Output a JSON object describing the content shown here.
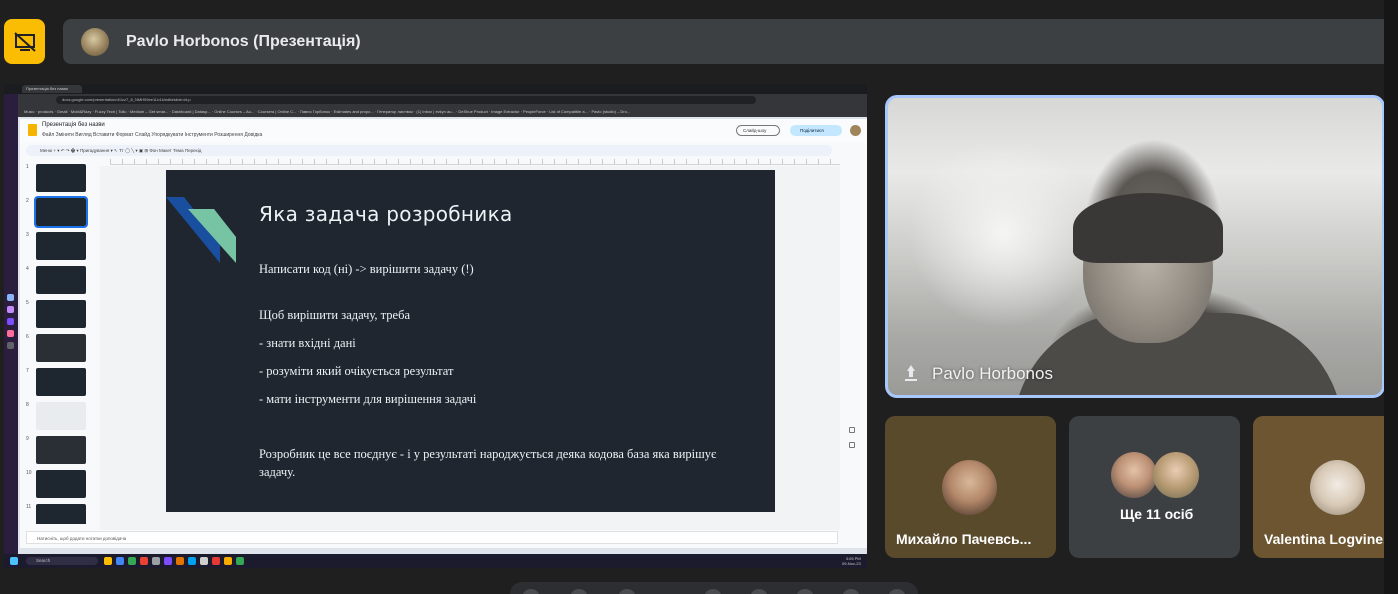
{
  "meeting": {
    "presenter_label": "Pavlo Horbonos (Презентація)"
  },
  "shared_screen": {
    "browser": {
      "tab_title": "Презентація без назви",
      "url": "docs.google.com/presentation/d/1cz7_8_NMH09ee1Lb1k/edit#slide=id.p",
      "bookmarks": "Music · products · Gmail · Mobi&Razy · Fuzzy Tech | Tollu · Medium – Get smar... · Dashboard | Datasp... · Online Courses – Au... · Coursera | Online C... · Павло Горбонос · Estimates and propo... · Генератор листівок · (1) Inbox | evkyn au... · DeShue Product · Image Extractor · PeopleForce · List of Compatible a... · Pavlo (studio) – Dro..."
    },
    "slides_app": {
      "doc_title": "Презентація без назви",
      "menu": "Файл   Змінити   Вигляд   Вставити   Формат   Слайд   Упорядкувати   Інструменти   Розширення   Довідка",
      "slideshow_button": "Слайд-шоу",
      "share_button": "Поділитися",
      "toolbar": "Меню   + ▾   ↶   ↷   🖶   ▾   Пригадування ▾   ↖   Tт   ◯   ╲ ▾   ▣   ⊞   Фон   Макет   Тема   Перехід",
      "notes_placeholder": "Натисніть, щоб додати нотатки доповідача",
      "thumbnail_numbers": [
        "1",
        "2",
        "3",
        "4",
        "5",
        "6",
        "7",
        "8",
        "9",
        "10",
        "11"
      ]
    },
    "slide": {
      "title": "Яка задача розробника",
      "line1": "Написати код (ні) -> вирішити задачу (!)",
      "line2": "Щоб вирішити задачу, треба",
      "line3": "- знати вхідні дані",
      "line4": "- розуміти який очікується результат",
      "line5": "- мати інструменти для вирішення задачі",
      "line6a": "Розробник це все поєднує - і у результаті народжується деяка кодова база яка вирішує",
      "line6b": "задачу."
    },
    "taskbar": {
      "search_label": "Search",
      "clock_time": "3:05 PM",
      "clock_date": "09-Nov-23"
    }
  },
  "speaker_tile": {
    "name": "Pavlo Horbonos"
  },
  "participants": [
    {
      "name": "Михайло Пачевсь..."
    },
    {
      "name": "Ще 11 осіб"
    },
    {
      "name": "Valentina Logvine..."
    }
  ],
  "colors": {
    "accent_yellow": "#fbbc04",
    "speaker_border": "#a8c7fa",
    "slide_bg": "#1f2630"
  }
}
